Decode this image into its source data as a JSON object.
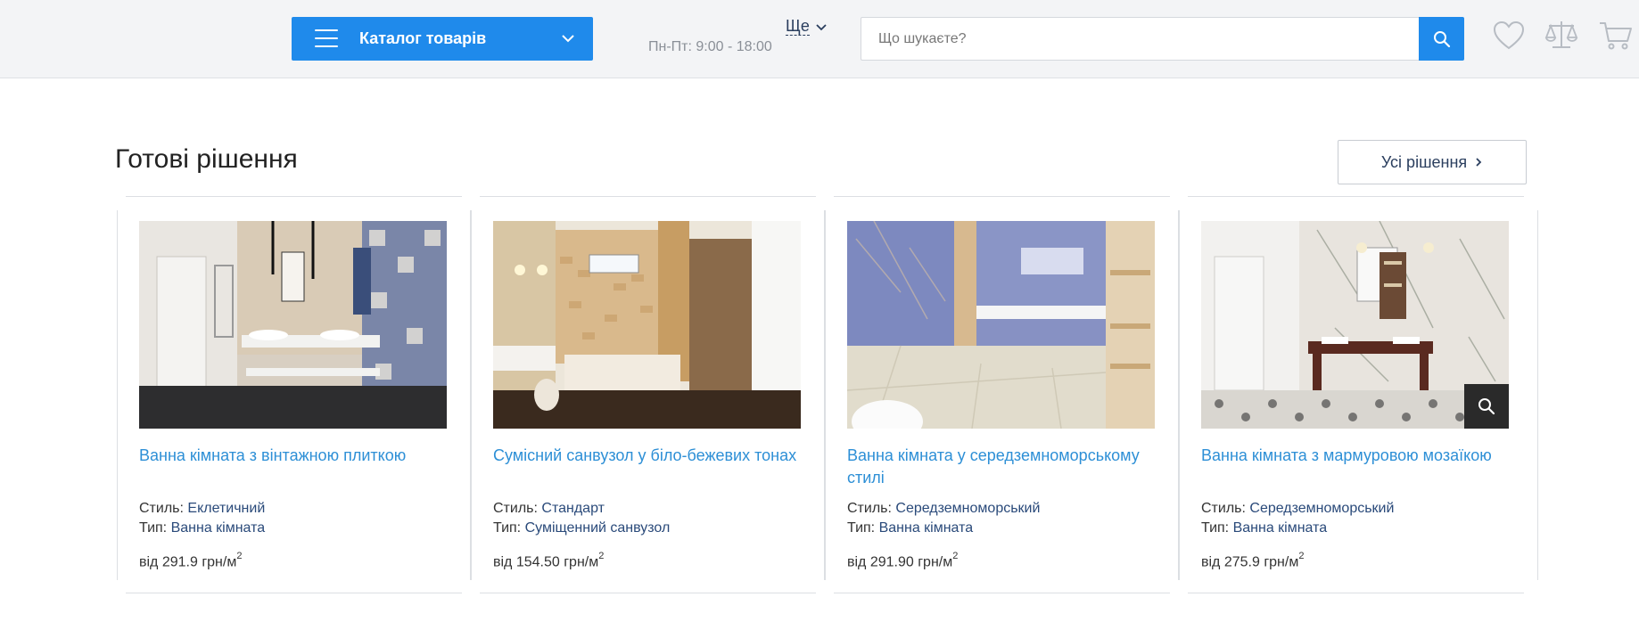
{
  "header": {
    "catalog_label": "Каталог товарів",
    "more_label": "Ще",
    "hours": "Пн-Пт: 9:00 - 18:00",
    "search_placeholder": "Що шукаєте?",
    "accent_color": "#1f8aeb"
  },
  "section": {
    "title": "Готові рішення",
    "all_label": "Усі рішення"
  },
  "cards": [
    {
      "name": "Ванна кімната з вінтажною плиткою",
      "style_label": "Стиль:",
      "style_value": "Еклетичний",
      "type_label": "Тип:",
      "type_value": "Ванна кімната",
      "price_prefix": "від 291.9 грн/м",
      "price_sup": "2"
    },
    {
      "name": "Сумісний санвузол у біло-бежевих тонах",
      "style_label": "Стиль:",
      "style_value": "Стандарт",
      "type_label": "Тип:",
      "type_value": "Суміщенний санвузол",
      "price_prefix": "від 154.50 грн/м",
      "price_sup": "2"
    },
    {
      "name": "Ванна кімната у середземноморському стилі",
      "style_label": "Стиль:",
      "style_value": "Середземноморський",
      "type_label": "Тип:",
      "type_value": "Ванна кімната",
      "price_prefix": "від 291.90 грн/м",
      "price_sup": "2"
    },
    {
      "name": "Ванна кімната з мармуровою мозаїкою",
      "style_label": "Стиль:",
      "style_value": "Середземноморський",
      "type_label": "Тип:",
      "type_value": "Ванна кімната",
      "price_prefix": "від 275.9 грн/м",
      "price_sup": "2"
    }
  ]
}
